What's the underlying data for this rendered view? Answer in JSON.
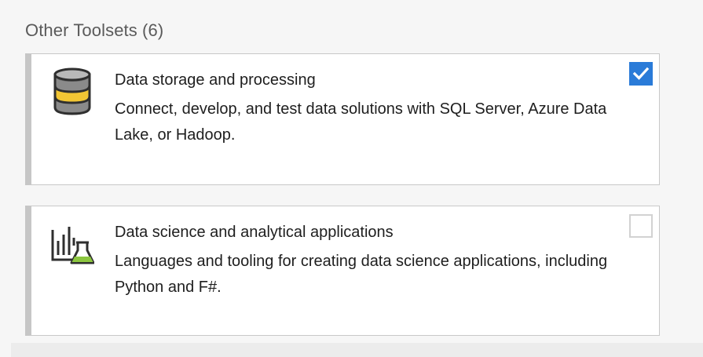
{
  "section": {
    "title": "Other Toolsets (6)"
  },
  "workloads": [
    {
      "title": "Data storage and processing",
      "description": "Connect, develop, and test data solutions with SQL Server, Azure Data Lake, or Hadoop.",
      "checked": true,
      "icon": "database-icon"
    },
    {
      "title": "Data science and analytical applications",
      "description": "Languages and tooling for creating data science applications, including Python and F#.",
      "checked": false,
      "icon": "data-science-flask-icon"
    }
  ],
  "colors": {
    "checkbox_checked": "#2a7bd8",
    "database_band": "#f2c634",
    "flask_liquid": "#8cc63f"
  }
}
